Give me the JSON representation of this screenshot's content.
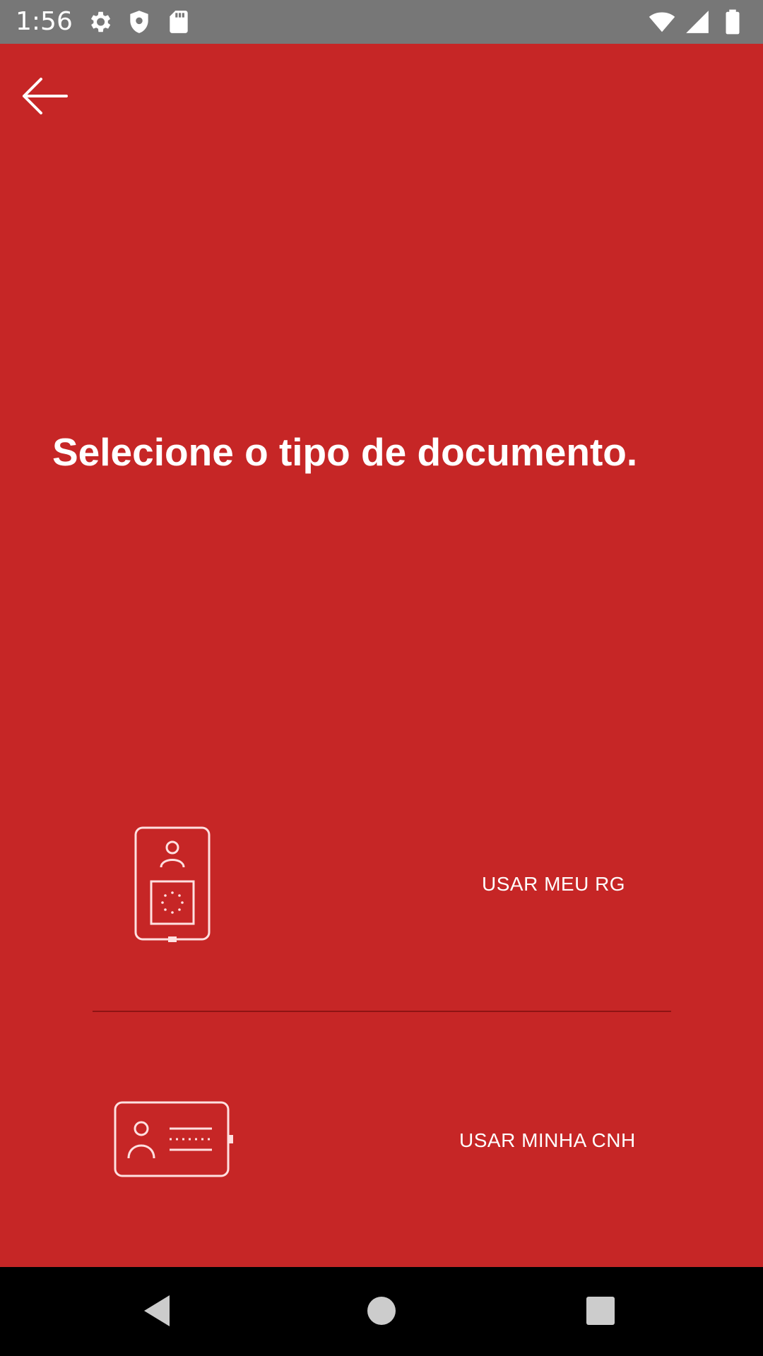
{
  "status_bar": {
    "time": "1:56",
    "left_icons": [
      "settings-icon",
      "shield-icon",
      "sd-card-icon"
    ],
    "right_icons": [
      "wifi-icon",
      "cell-signal-icon",
      "battery-icon"
    ]
  },
  "header": {
    "back_icon": "arrow-left-icon"
  },
  "main": {
    "title": "Selecione o tipo de documento.",
    "options": [
      {
        "label": "USAR MEU RG",
        "icon": "id-card-vertical-icon"
      },
      {
        "label": "USAR MINHA CNH",
        "icon": "driver-license-icon"
      }
    ]
  },
  "nav_bar": {
    "buttons": [
      "back-triangle-icon",
      "home-circle-icon",
      "recents-square-icon"
    ]
  },
  "colors": {
    "background": "#c62626",
    "status_bar": "#777777",
    "divider": "#8e1414",
    "nav_bar": "#000000",
    "foreground": "#ffffff"
  }
}
